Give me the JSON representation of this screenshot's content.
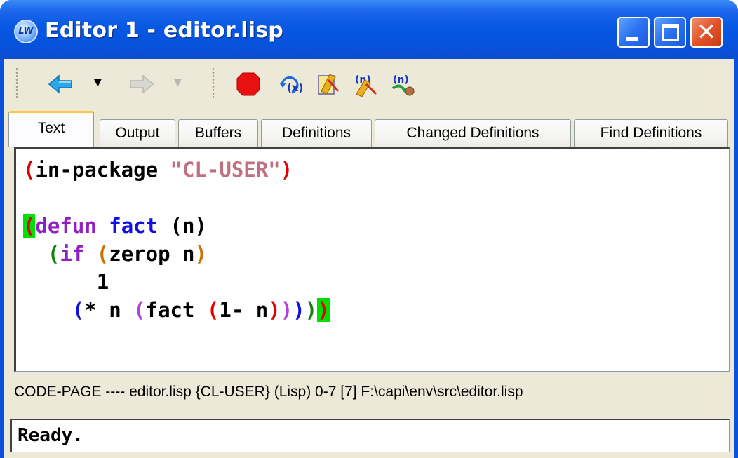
{
  "window": {
    "title": "Editor 1 - editor.lisp",
    "app_icon_text": "LW",
    "close_glyph": "✕"
  },
  "toolbar": {
    "back_dropdown": "▼",
    "forward_dropdown": "▼",
    "icons": [
      "back-arrow-icon",
      "forward-arrow-icon",
      "stop-icon",
      "evaluate-icon",
      "compile-definition-icon",
      "compile-buffer-icon",
      "debug-step-icon"
    ]
  },
  "tabs": [
    {
      "label": "Text",
      "active": true
    },
    {
      "label": "Output"
    },
    {
      "label": "Buffers"
    },
    {
      "label": "Definitions"
    },
    {
      "label": "Changed Definitions"
    },
    {
      "label": "Find Definitions"
    }
  ],
  "code": {
    "line1": [
      {
        "t": "(",
        "c": "#e00000"
      },
      {
        "t": "in-package ",
        "c": "#000000"
      },
      {
        "t": "\"CL-USER\"",
        "c": "#c07080"
      },
      {
        "t": ")",
        "c": "#e00000"
      }
    ],
    "line3": [
      {
        "t": "(",
        "c": "#e00000",
        "hl": true
      },
      {
        "t": "defun",
        "c": "#9020c0"
      },
      {
        "t": " ",
        "c": "#000000"
      },
      {
        "t": "fact",
        "c": "#1010e0"
      },
      {
        "t": " (n)",
        "c": "#000000"
      }
    ],
    "line4": [
      {
        "t": "  ",
        "c": "#000000"
      },
      {
        "t": "(",
        "c": "#108010"
      },
      {
        "t": "if",
        "c": "#9020c0"
      },
      {
        "t": " ",
        "c": "#000000"
      },
      {
        "t": "(",
        "c": "#d07000"
      },
      {
        "t": "zerop n",
        "c": "#000000"
      },
      {
        "t": ")",
        "c": "#d07000"
      }
    ],
    "line5": [
      {
        "t": "      1",
        "c": "#000000"
      }
    ],
    "line6": [
      {
        "t": "    ",
        "c": "#000000"
      },
      {
        "t": "(",
        "c": "#1010e0"
      },
      {
        "t": "* n ",
        "c": "#000000"
      },
      {
        "t": "(",
        "c": "#b040e0"
      },
      {
        "t": "fact ",
        "c": "#000000"
      },
      {
        "t": "(",
        "c": "#e00000"
      },
      {
        "t": "1- n",
        "c": "#000000"
      },
      {
        "t": ")",
        "c": "#e00000"
      },
      {
        "t": ")",
        "c": "#b040e0"
      },
      {
        "t": ")",
        "c": "#1010e0"
      },
      {
        "t": ")",
        "c": "#108010"
      },
      {
        "t": ")",
        "c": "#e00000",
        "hl": true
      }
    ]
  },
  "modeline": {
    "text": "CODE-PAGE ---- editor.lisp    {CL-USER} (Lisp) 0-7 [7] F:\\capi\\env\\src\\editor.lisp"
  },
  "echo_area": {
    "text": "Ready."
  }
}
